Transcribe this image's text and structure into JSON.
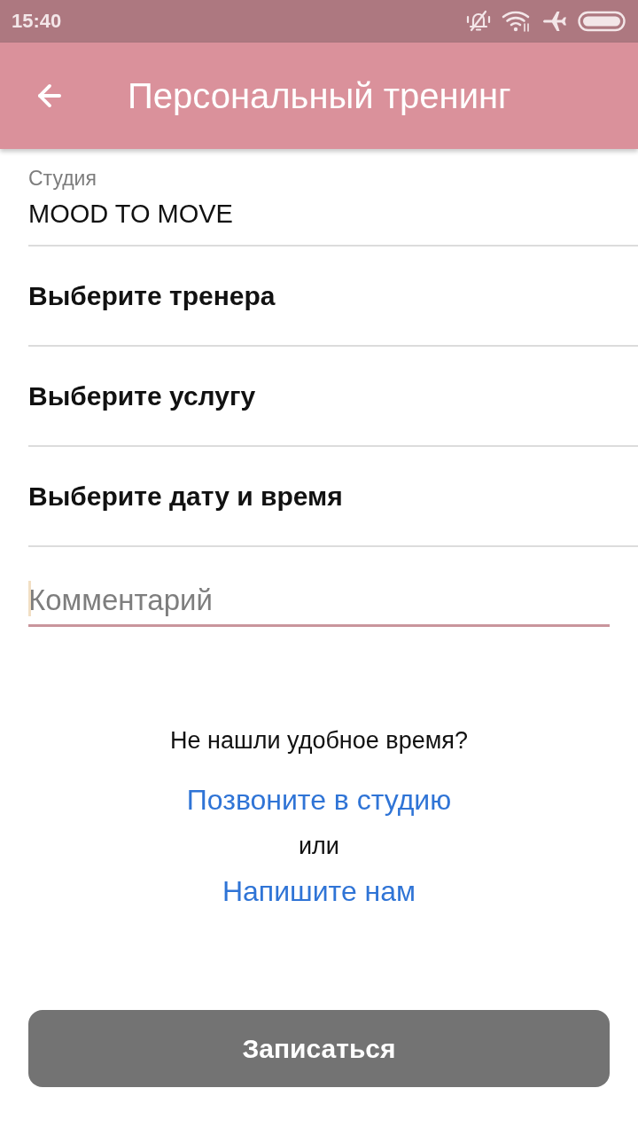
{
  "status_bar": {
    "time": "15:40"
  },
  "app_bar": {
    "title": "Персональный тренинг"
  },
  "studio": {
    "label": "Студия",
    "value": "MOOD TO MOVE"
  },
  "selectors": [
    {
      "label": "Выберите тренера"
    },
    {
      "label": "Выберите услугу"
    },
    {
      "label": "Выберите дату и время"
    }
  ],
  "comment": {
    "placeholder": "Комментарий",
    "focused": true
  },
  "help": {
    "question": "Не нашли удобное время?",
    "call_link": "Позвоните в студию",
    "or": "или",
    "write_link": "Напишите нам"
  },
  "submit": {
    "label": "Записаться",
    "disabled": true
  }
}
